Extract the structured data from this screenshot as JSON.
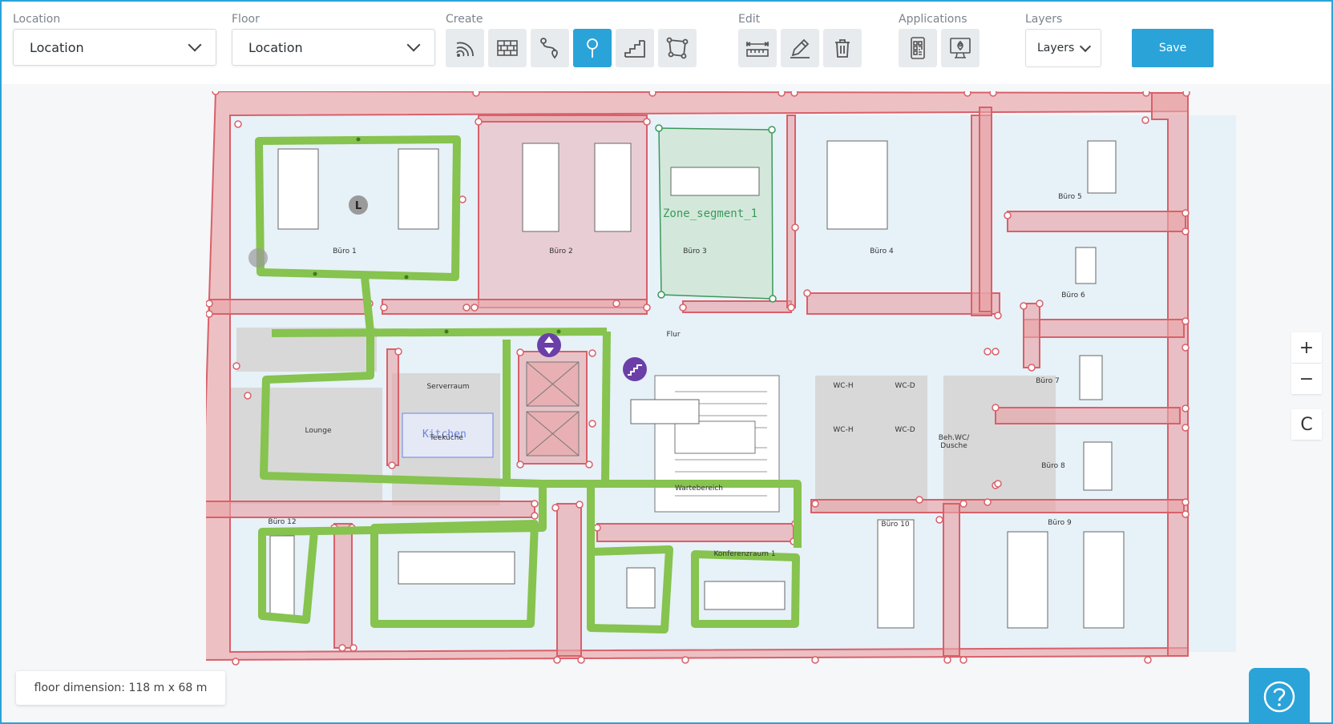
{
  "toolbar": {
    "location_label": "Location",
    "location_value": "Location",
    "floor_label": "Floor",
    "floor_value": "Location",
    "create_label": "Create",
    "edit_label": "Edit",
    "applications_label": "Applications",
    "layers_label": "Layers",
    "layers_value": "Layers",
    "save_label": "Save",
    "create_tools": [
      "wifi-icon",
      "wall-icon",
      "route-icon",
      "pin-icon",
      "stairs-icon",
      "polygon-icon"
    ],
    "edit_tools": [
      "measure-icon",
      "pencil-icon",
      "trash-icon"
    ],
    "application_tools": [
      "qr-code-icon",
      "kiosk-icon"
    ],
    "active_tool": "pin-icon"
  },
  "colors": {
    "accent": "#2aa3d9",
    "wall_fill": "#e8a5a8",
    "wall_stroke": "#d9606a",
    "route": "#86c34f",
    "zone": "#3a9a5a",
    "room_fill": "#e7f1f8"
  },
  "plan": {
    "zone_label": "Zone_segment_1",
    "kitchen_label": "Kitchen",
    "marker_label": "L",
    "rooms": {
      "buero1": "Büro 1",
      "buero2": "Büro 2",
      "buero3": "Büro 3",
      "buero4": "Büro 4",
      "buero5": "Büro 5",
      "buero6": "Büro 6",
      "buero7": "Büro 7",
      "buero8": "Büro 8",
      "buero9": "Büro 9",
      "buero10": "Büro 10",
      "buero12": "Büro 12",
      "flur": "Flur",
      "serverraum": "Serverraum",
      "teekueche": "Teeküche",
      "lounge": "Lounge",
      "wch1": "WC-H",
      "wch2": "WC-H",
      "wcd1": "WC-D",
      "wcd2": "WC-D",
      "behwc": "Beh.WC/",
      "dusche": "Dusche",
      "wartebereich": "Wartebereich",
      "konferenz": "Konferenzraum 1"
    }
  },
  "map_controls": {
    "zoom_in": "+",
    "zoom_out": "−",
    "reset": "C"
  },
  "footer": {
    "floor_dimension": "floor dimension: 118 m x 68 m"
  }
}
